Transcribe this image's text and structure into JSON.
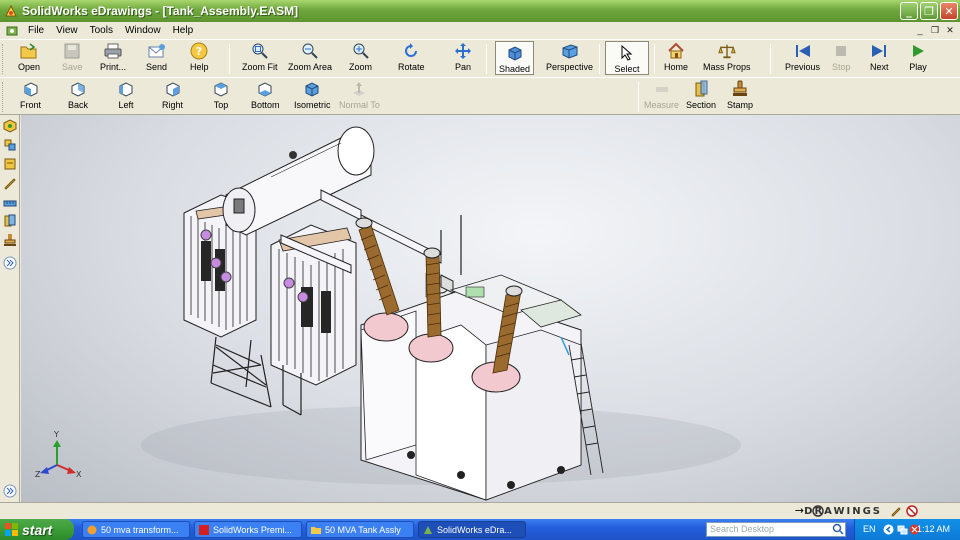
{
  "window": {
    "title": "SolidWorks eDrawings - [Tank_Assembly.EASM]"
  },
  "menu": {
    "items": [
      "File",
      "View",
      "Tools",
      "Window",
      "Help"
    ]
  },
  "toolbar1": {
    "open": "Open",
    "save": "Save",
    "print": "Print...",
    "send": "Send",
    "help": "Help",
    "zoom_fit": "Zoom Fit",
    "zoom_area": "Zoom Area",
    "zoom": "Zoom",
    "rotate": "Rotate",
    "pan": "Pan",
    "shaded": "Shaded",
    "perspective": "Perspective",
    "select": "Select",
    "home": "Home",
    "mass_props": "Mass Props",
    "previous": "Previous",
    "stop": "Stop",
    "next": "Next",
    "play": "Play"
  },
  "toolbar2": {
    "front": "Front",
    "back": "Back",
    "left": "Left",
    "right": "Right",
    "top": "Top",
    "bottom": "Bottom",
    "isometric": "Isometric",
    "normal_to": "Normal To",
    "measure": "Measure",
    "section": "Section",
    "stamp": "Stamp"
  },
  "triad": {
    "x": "X",
    "y": "Y",
    "z": "Z"
  },
  "statusbar": {
    "brand": "DRAWINGS"
  },
  "taskbar": {
    "start": "start",
    "tasks": [
      "50 mva transform...",
      "SolidWorks Premi...",
      "50 MVA Tank Assly",
      "SolidWorks eDra..."
    ],
    "search_placeholder": "Search Desktop",
    "lang": "EN",
    "clock": "1:12 AM"
  },
  "colors": {
    "title_bar": "#6fa83c",
    "taskbar": "#245edb",
    "start": "#3c9d36",
    "viewport": "#d9dde3"
  }
}
